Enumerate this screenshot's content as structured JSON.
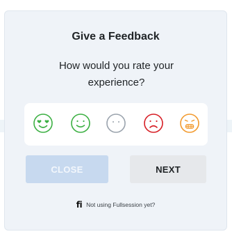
{
  "dialog": {
    "title": "Give a Feedback",
    "question": "How would you rate your experience?"
  },
  "ratings": [
    {
      "name": "love",
      "color": "#3cb043",
      "icon": "heart-eyes-face-icon"
    },
    {
      "name": "happy",
      "color": "#3cb043",
      "icon": "smiley-face-icon"
    },
    {
      "name": "neutral",
      "color": "#9aa3ad",
      "icon": "neutral-face-icon"
    },
    {
      "name": "sad",
      "color": "#d71f26",
      "icon": "frown-face-icon"
    },
    {
      "name": "angry",
      "color": "#f29a2e",
      "icon": "grimace-face-icon"
    }
  ],
  "buttons": {
    "close_label": "CLOSE",
    "next_label": "NEXT"
  },
  "footer": {
    "logo_text": "fi",
    "text": "Not using Fullsession yet?"
  },
  "colors": {
    "card_bg": "#eff3f8",
    "close_bg": "#c7d9ef",
    "next_bg": "#e6e8eb"
  }
}
